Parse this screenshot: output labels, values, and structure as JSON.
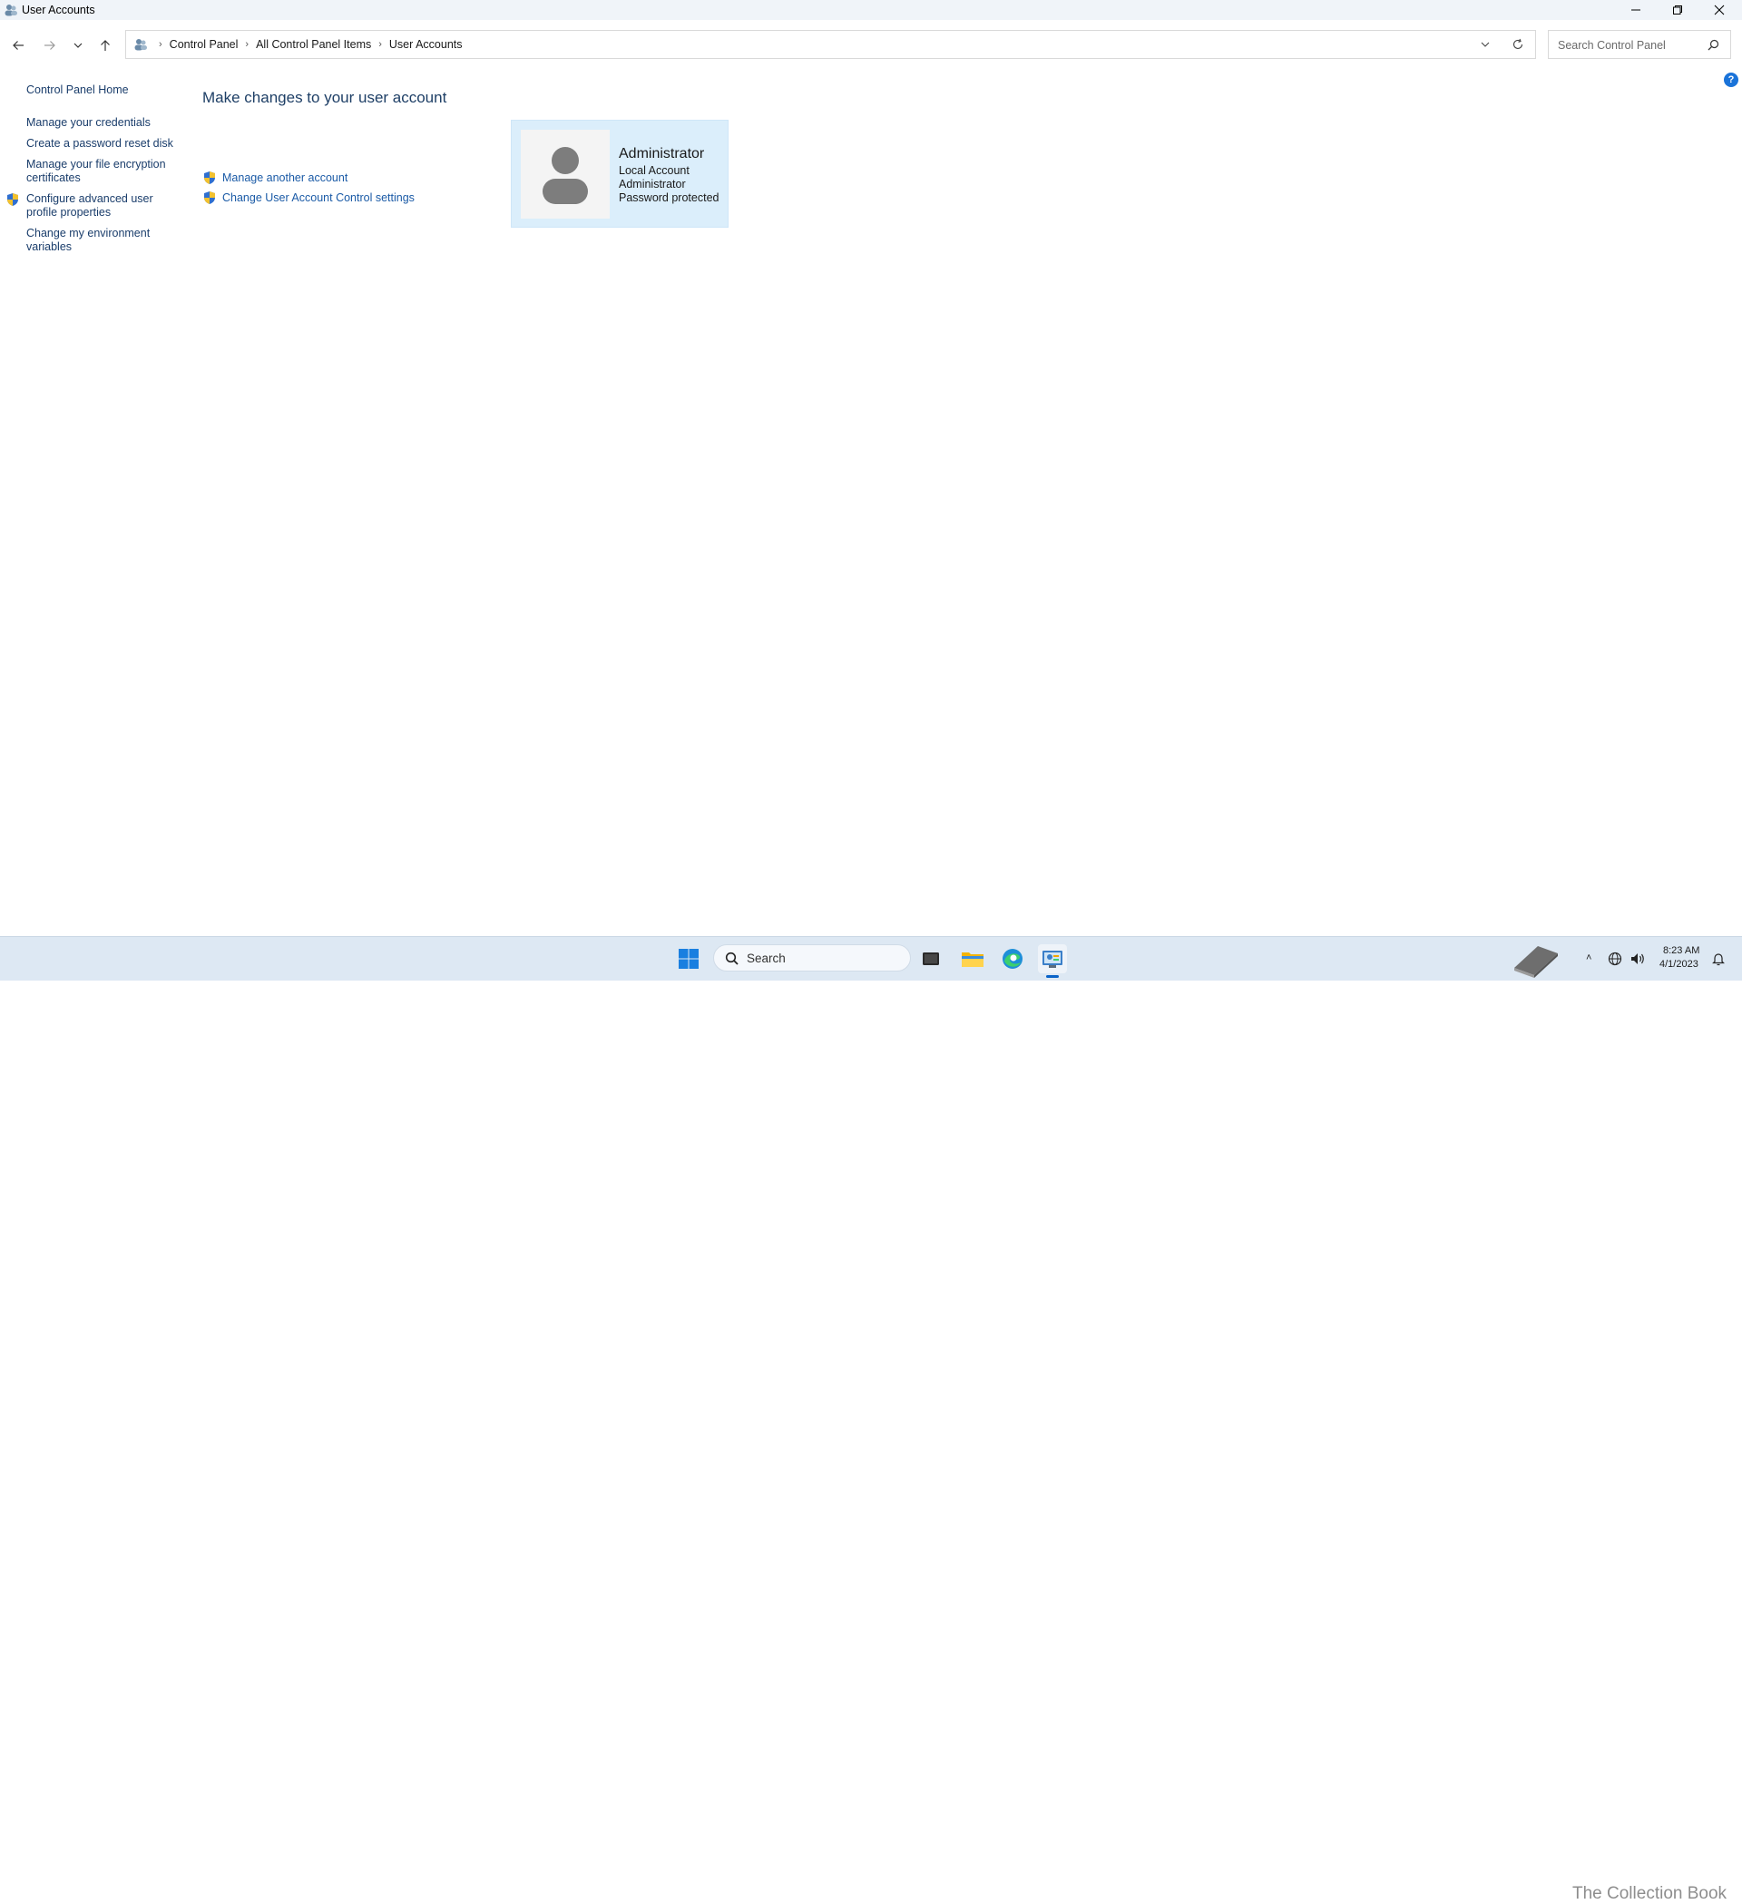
{
  "window": {
    "title": "User Accounts"
  },
  "address": {
    "crumbs": [
      "Control Panel",
      "All Control Panel Items",
      "User Accounts"
    ],
    "search_placeholder": "Search Control Panel"
  },
  "left_pane": {
    "home": "Control Panel Home",
    "links": [
      {
        "label": "Manage your credentials",
        "shield": false
      },
      {
        "label": "Create a password reset disk",
        "shield": false
      },
      {
        "label_line1": "Manage your file encryption",
        "label_line2": "certificates",
        "shield": false
      },
      {
        "label_line1": "Configure advanced user",
        "label_line2": "profile properties",
        "shield": true
      },
      {
        "label_line1": "Change my environment",
        "label_line2": "variables",
        "shield": false
      }
    ]
  },
  "main": {
    "heading": "Make changes to your user account",
    "tasks": [
      {
        "label": "Manage another account",
        "shield": true
      },
      {
        "label": "Change User Account Control settings",
        "shield": true
      }
    ],
    "account": {
      "name": "Administrator",
      "type": "Local Account",
      "role": "Administrator",
      "status": "Password protected"
    }
  },
  "taskbar": {
    "search_label": "Search",
    "time": "8:23 AM",
    "date": "4/1/2023",
    "watermark": "The Collection Book"
  },
  "colors": {
    "link": "#1a5aa6",
    "heading": "#1e3f66",
    "tile_bg": "#dbeefb",
    "taskbar_bg": "#dde8f3",
    "accent": "#0a63c8"
  }
}
